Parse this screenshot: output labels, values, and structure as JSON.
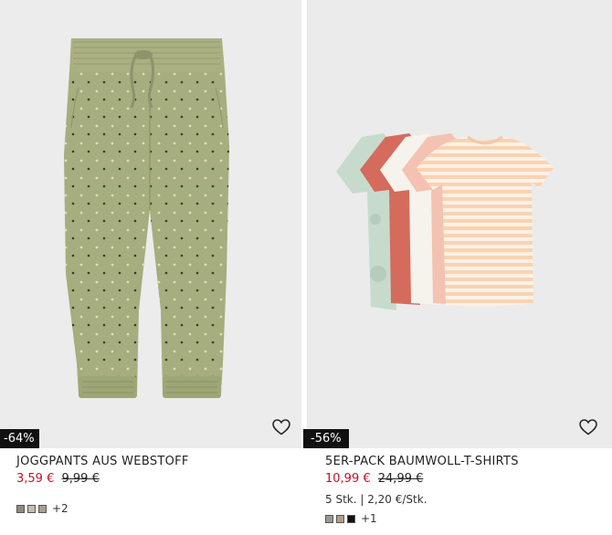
{
  "products": [
    {
      "badge": "-64%",
      "title": "JOGGPANTS AUS WEBSTOFF",
      "price_sale": "3,59 €",
      "price_old": "9,99 €",
      "swatch_colors": [
        "#8d8a80",
        "#c6bcaa",
        "#a89f8f"
      ],
      "swatch_more": "+2",
      "icon": "heart-icon"
    },
    {
      "badge": "-56%",
      "title": "5ER-PACK BAUMWOLL-T-SHIRTS",
      "price_sale": "10,99 €",
      "price_old": "24,99 €",
      "meta": "5 Stk. | 2,20 €/Stk.",
      "swatch_colors": [
        "#9a9a92",
        "#b89a86",
        "#111111"
      ],
      "swatch_more": "+1",
      "icon": "heart-icon"
    }
  ]
}
